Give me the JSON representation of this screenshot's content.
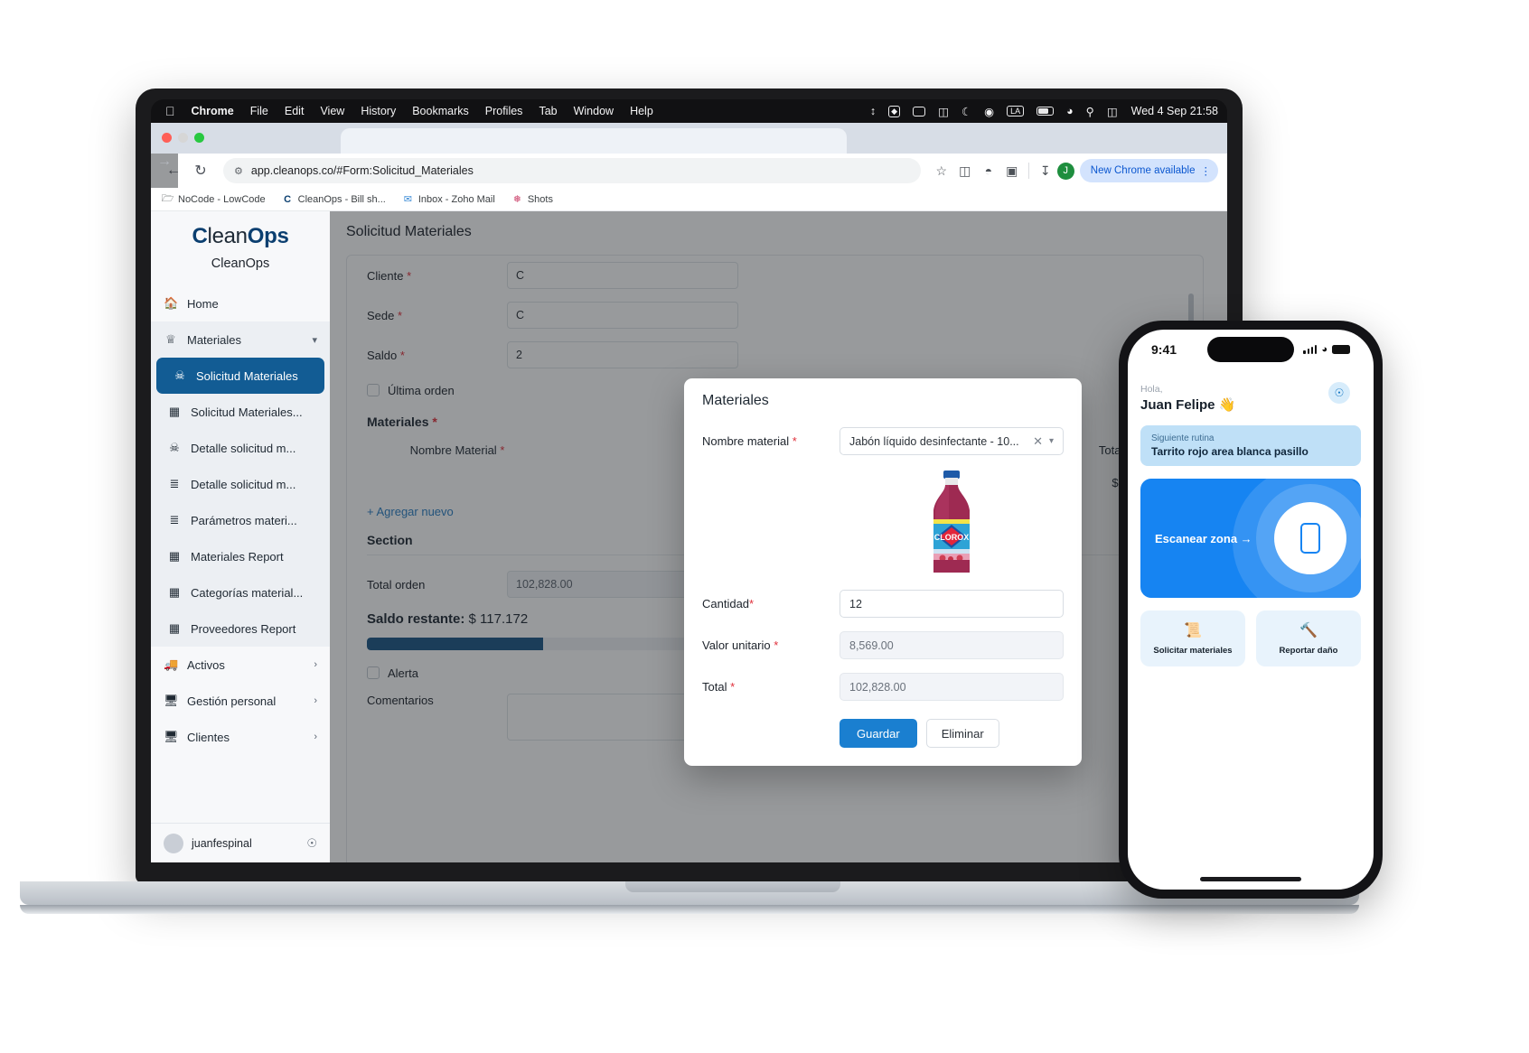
{
  "macbar": {
    "apple": "apple-logo",
    "items": [
      "Chrome",
      "File",
      "Edit",
      "View",
      "History",
      "Bookmarks",
      "Profiles",
      "Tab",
      "Window",
      "Help"
    ],
    "status_icons": [
      "arrows-up-down-icon",
      "dropbox-icon",
      "display-icon",
      "usb-icon",
      "moon-icon",
      "record-icon",
      "input-source-la-icon",
      "battery-icon",
      "wifi-icon",
      "search-icon",
      "control-center-icon"
    ],
    "input_source": "LA",
    "clock": "Wed 4 Sep  21:58"
  },
  "browser": {
    "back": "back-arrow",
    "forward": "forward-arrow",
    "reload": "reload-arrow",
    "url": "app.cleanops.co/#Form:Solicitud_Materiales",
    "site_info_icon": "tune-icon",
    "star_icon": "bookmark-star-icon",
    "split_icon": "split-screen-icon",
    "ext_icon": "extensions-icon",
    "puzzle_icon": "puzzle-icon",
    "download_icon": "download-icon",
    "profile_initial": "J",
    "update_pill": "New Chrome available",
    "update_menu": "⋮",
    "bookmarks": [
      {
        "label": "NoCode - LowCode",
        "icon": "folder-icon"
      },
      {
        "label": "CleanOps - Bill sh...",
        "icon": "cleanops-c-icon"
      },
      {
        "label": "Inbox - Zoho Mail",
        "icon": "zoho-mail-icon"
      },
      {
        "label": "Shots",
        "icon": "shots-icon"
      }
    ]
  },
  "sidebar": {
    "brand_part1": "C",
    "brand_part2": "lean",
    "brand_part3": "Ops",
    "brand_sub": "CleanOps",
    "items": [
      {
        "label": "Home",
        "icon": "home-icon",
        "type": "item"
      },
      {
        "label": "Materiales",
        "icon": "person-icon",
        "type": "group",
        "chevron": "chevron-down-icon"
      },
      {
        "label": "Solicitud Materiales",
        "icon": "shirt-icon",
        "type": "sub",
        "active": true
      },
      {
        "label": "Solicitud Materiales...",
        "icon": "report-icon",
        "type": "sub"
      },
      {
        "label": "Detalle solicitud m...",
        "icon": "shirt-icon",
        "type": "sub"
      },
      {
        "label": "Detalle solicitud m...",
        "icon": "list-icon",
        "type": "sub"
      },
      {
        "label": "Parámetros materi...",
        "icon": "list-icon",
        "type": "sub"
      },
      {
        "label": "Materiales Report",
        "icon": "report-icon",
        "type": "sub"
      },
      {
        "label": "Categorías material...",
        "icon": "report-icon",
        "type": "sub"
      },
      {
        "label": "Proveedores Report",
        "icon": "report-icon",
        "type": "sub"
      },
      {
        "label": "Activos",
        "icon": "truck-icon",
        "type": "group",
        "chevron": "chevron-right-icon"
      },
      {
        "label": "Gestión personal",
        "icon": "monitor-icon",
        "type": "group",
        "chevron": "chevron-right-icon"
      },
      {
        "label": "Clientes",
        "icon": "monitor-icon",
        "type": "group",
        "chevron": "chevron-right-icon"
      }
    ],
    "user": "juanfespinal",
    "bell_icon": "bell-icon"
  },
  "page": {
    "title": "Solicitud Materiales",
    "fields": [
      {
        "label": "Cliente",
        "required": true,
        "value": "C"
      },
      {
        "label": "Sede",
        "required": true,
        "value": "C"
      },
      {
        "label": "Saldo",
        "required": true,
        "value": "2"
      }
    ],
    "checkbox_ultima": "Última orden",
    "materiales_header": "Materiales",
    "table_headers": {
      "nombre": "Nombre Material",
      "total": "Total"
    },
    "table_row_total": "$",
    "add_new": "+ Agregar nuevo",
    "section_title": "Section",
    "total_orden_label": "Total orden",
    "total_orden_value": "102,828.00",
    "saldo_label": "Saldo restante:",
    "saldo_value": "$ 117.172",
    "progress_percent": 47,
    "checkbox_alerta": "Alerta",
    "comentarios_label": "Comentarios"
  },
  "modal": {
    "title": "Materiales",
    "nombre_label": "Nombre material",
    "nombre_value": "Jabón líquido desinfectante - 10...",
    "clear_icon": "close-icon",
    "dropdown_icon": "chevron-down-icon",
    "product_image": "clorox-bottle-image",
    "cantidad_label": "Cantidad",
    "cantidad_value": "12",
    "valor_label": "Valor unitario",
    "valor_value": "8,569.00",
    "total_label": "Total",
    "total_value": "102,828.00",
    "save_label": "Guardar",
    "delete_label": "Eliminar"
  },
  "phone": {
    "time": "9:41",
    "signal_icon": "cellular-bars-icon",
    "wifi_icon": "wifi-icon",
    "battery_icon": "battery-icon",
    "greeting_small": "Hola,",
    "greeting_name": "Juan Felipe 👋",
    "bell_icon": "notification-icon",
    "routine_small": "Siguiente rutina",
    "routine_title": "Tarrito rojo area blanca pasillo",
    "scan_label": "Escanear zona →",
    "scan_icon": "phone-scan-icon",
    "tiles": [
      {
        "label": "Solicitar materiales",
        "icon": "paper-roll-icon"
      },
      {
        "label": "Reportar daño",
        "icon": "tools-icon"
      }
    ]
  },
  "colors": {
    "accent_blue": "#1a7fd0",
    "sidebar_active": "#125c94",
    "progress": "#1c5786",
    "required_red": "#e0303b",
    "phone_blue": "#1684f2"
  }
}
